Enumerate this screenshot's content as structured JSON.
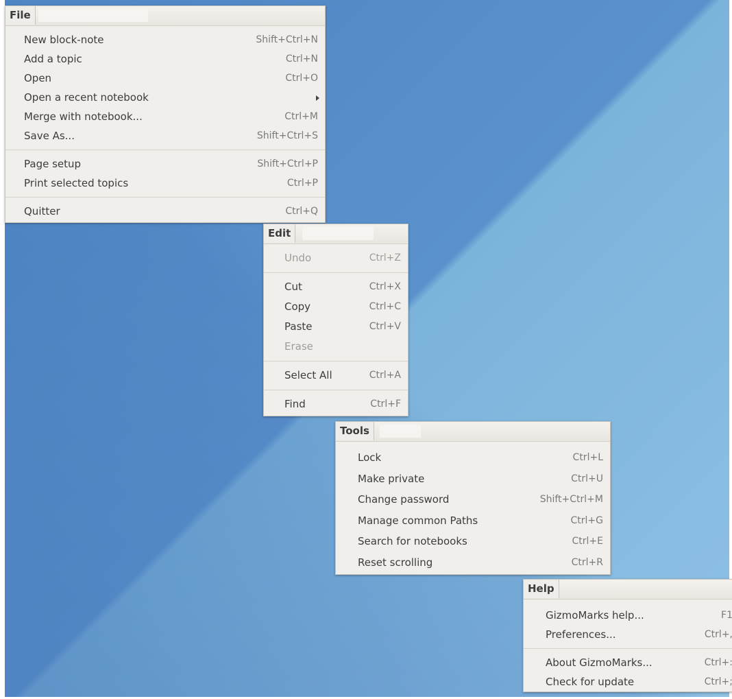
{
  "menus": {
    "file": {
      "title": "File",
      "items": [
        {
          "label": "New block-note",
          "accel": "Shift+Ctrl+N"
        },
        {
          "label": "Add a topic",
          "accel": "Ctrl+N"
        },
        {
          "label": "Open",
          "accel": "Ctrl+O"
        },
        {
          "label": "Open a recent notebook",
          "accel": ""
        },
        {
          "label": "Merge with notebook...",
          "accel": "Ctrl+M"
        },
        {
          "label": "Save As...",
          "accel": "Shift+Ctrl+S"
        },
        {
          "label": "Page setup",
          "accel": "Shift+Ctrl+P"
        },
        {
          "label": "Print selected topics",
          "accel": "Ctrl+P"
        },
        {
          "label": "Quitter",
          "accel": "Ctrl+Q"
        }
      ]
    },
    "edit": {
      "title": "Edit",
      "items": [
        {
          "label": "Undo",
          "accel": "Ctrl+Z"
        },
        {
          "label": "Cut",
          "accel": "Ctrl+X"
        },
        {
          "label": "Copy",
          "accel": "Ctrl+C"
        },
        {
          "label": "Paste",
          "accel": "Ctrl+V"
        },
        {
          "label": "Erase",
          "accel": ""
        },
        {
          "label": "Select All",
          "accel": "Ctrl+A"
        },
        {
          "label": "Find",
          "accel": "Ctrl+F"
        }
      ]
    },
    "tools": {
      "title": "Tools",
      "items": [
        {
          "label": "Lock",
          "accel": "Ctrl+L"
        },
        {
          "label": "Make private",
          "accel": "Ctrl+U"
        },
        {
          "label": "Change password",
          "accel": "Shift+Ctrl+M"
        },
        {
          "label": "Manage common Paths",
          "accel": "Ctrl+G"
        },
        {
          "label": "Search for notebooks",
          "accel": "Ctrl+E"
        },
        {
          "label": "Reset scrolling",
          "accel": "Ctrl+R"
        }
      ]
    },
    "help": {
      "title": "Help",
      "items": [
        {
          "label": "GizmoMarks help...",
          "accel": "F1"
        },
        {
          "label": "Preferences...",
          "accel": "Ctrl+,"
        },
        {
          "label": "About GizmoMarks...",
          "accel": "Ctrl+:"
        },
        {
          "label": "Check for update",
          "accel": "Ctrl+;"
        }
      ]
    }
  }
}
